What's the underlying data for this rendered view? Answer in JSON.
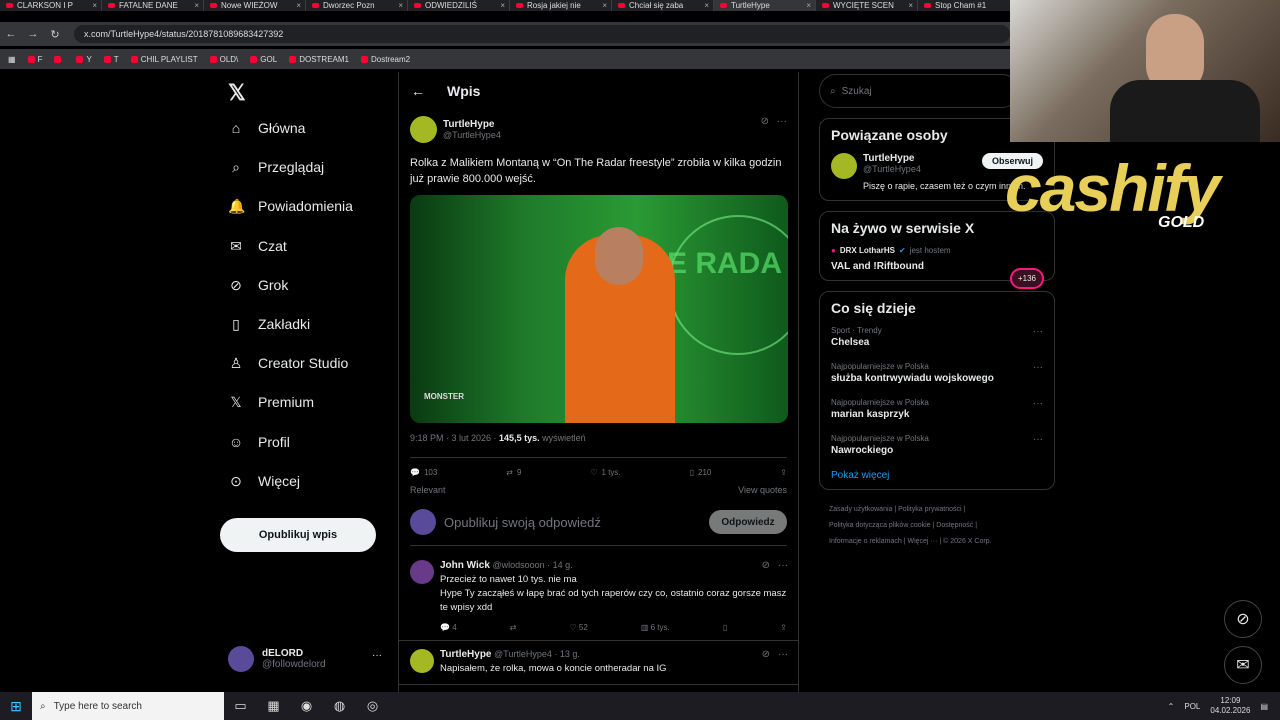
{
  "browser": {
    "tabs": [
      "CLARKSON I P",
      "FATALNE DANE",
      "Nowe WIEŻOW",
      "Dworzec Pozn",
      "ODWIEDZILIŚ",
      "Rosja jakiej nie",
      "Chciał się zaba",
      "TurtleHype",
      "WYCIĘTE SCEN",
      "Stop Cham #1"
    ],
    "url": "x.com/TurtleHype4/status/2018781089683427392",
    "bookmarks": [
      "F",
      "",
      "Y",
      "T",
      "CHIL PLAYLIST",
      "OLD\\",
      "GOL",
      "DOSTREAM1",
      "Dostream2"
    ]
  },
  "nav": {
    "items": [
      {
        "label": "Główna",
        "icon": "home-icon"
      },
      {
        "label": "Przeglądaj",
        "icon": "search-icon"
      },
      {
        "label": "Powiadomienia",
        "icon": "bell-icon"
      },
      {
        "label": "Czat",
        "icon": "mail-icon"
      },
      {
        "label": "Grok",
        "icon": "grok-icon"
      },
      {
        "label": "Zakładki",
        "icon": "bookmark-icon"
      },
      {
        "label": "Creator Studio",
        "icon": "creator-icon"
      },
      {
        "label": "Premium",
        "icon": "x-icon"
      },
      {
        "label": "Profil",
        "icon": "person-icon"
      },
      {
        "label": "Więcej",
        "icon": "more-circle-icon"
      }
    ],
    "post_button": "Opublikuj wpis",
    "account": {
      "name": "dELORD",
      "handle": "@followdelord"
    }
  },
  "main": {
    "header": "Wpis",
    "tweet": {
      "name": "TurtleHype",
      "handle": "@TurtleHype4",
      "text": "Rolka z Malikiem Montaną w “On The Radar freestyle” zrobiła w kilka godzin już prawie 800.000 wejść.",
      "media_text": "ON THE RADA",
      "media_brand": "MONSTER",
      "time": "9:18 PM · 3 lut 2026 · ",
      "views": "145,5 tys.",
      "views_label": " wyświetleń",
      "replies": "103",
      "reposts": "9",
      "likes": "1 tys.",
      "bookmarks": "210",
      "relevant": "Relevant",
      "view_quotes": "View quotes"
    },
    "reply": {
      "placeholder": "Opublikuj swoją odpowiedź",
      "button": "Odpowiedz"
    },
    "comments": [
      {
        "name": "John Wick",
        "handle": "@wlodsooon · 14 g.",
        "text": "Przecież to nawet 10 tys. nie ma\nHype Ty zacząłeś w łapę brać od tych raperów czy co, ostatnio coraz gorsze masz te wpisy xdd",
        "replies": "4",
        "reposts": "",
        "likes": "52",
        "views": "6 tys.",
        "avatar": "#6a3a8a"
      },
      {
        "name": "TurtleHype",
        "handle": "@TurtleHype4 · 13 g.",
        "text": "Napisałem, że rolka, mowa o koncie ontheradar na IG",
        "replies": "",
        "reposts": "",
        "likes": "",
        "views": "",
        "avatar": "#a4b823"
      }
    ]
  },
  "right": {
    "search_placeholder": "Szukaj",
    "related_title": "Powiązane osoby",
    "related": {
      "name": "TurtleHype",
      "handle": "@TurtleHype4",
      "bio": "Piszę o rapie, czasem też o czym innym.",
      "follow": "Obserwuj"
    },
    "live_title": "Na żywo w serwisie X",
    "live": {
      "host": "DRX LotharHS",
      "host_label": "jest hostem",
      "title": "VAL and !Riftbound",
      "count": "+136"
    },
    "trends_title": "Co się dzieje",
    "trends": [
      {
        "context": "Sport · Trendy",
        "title": "Chelsea"
      },
      {
        "context": "Najpopularniejsze w Polska",
        "title": "służba kontrwywiadu wojskowego"
      },
      {
        "context": "Najpopularniejsze w Polska",
        "title": "marian kasprzyk"
      },
      {
        "context": "Najpopularniejsze w Polska",
        "title": "Nawrockiego"
      }
    ],
    "show_more": "Pokaż więcej",
    "footer": [
      "Zasady użytkowania",
      "Polityka prywatności",
      "Polityka dotycząca plików cookie",
      "Dostępność",
      "Informacje o reklamach",
      "Więcej ···",
      "© 2026 X Corp."
    ]
  },
  "overlay": {
    "brand": "cashify",
    "brand_sub": "GOLD"
  },
  "taskbar": {
    "search": "Type here to search",
    "lang": "POL",
    "time": "12:09",
    "date": "04.02.2026"
  }
}
